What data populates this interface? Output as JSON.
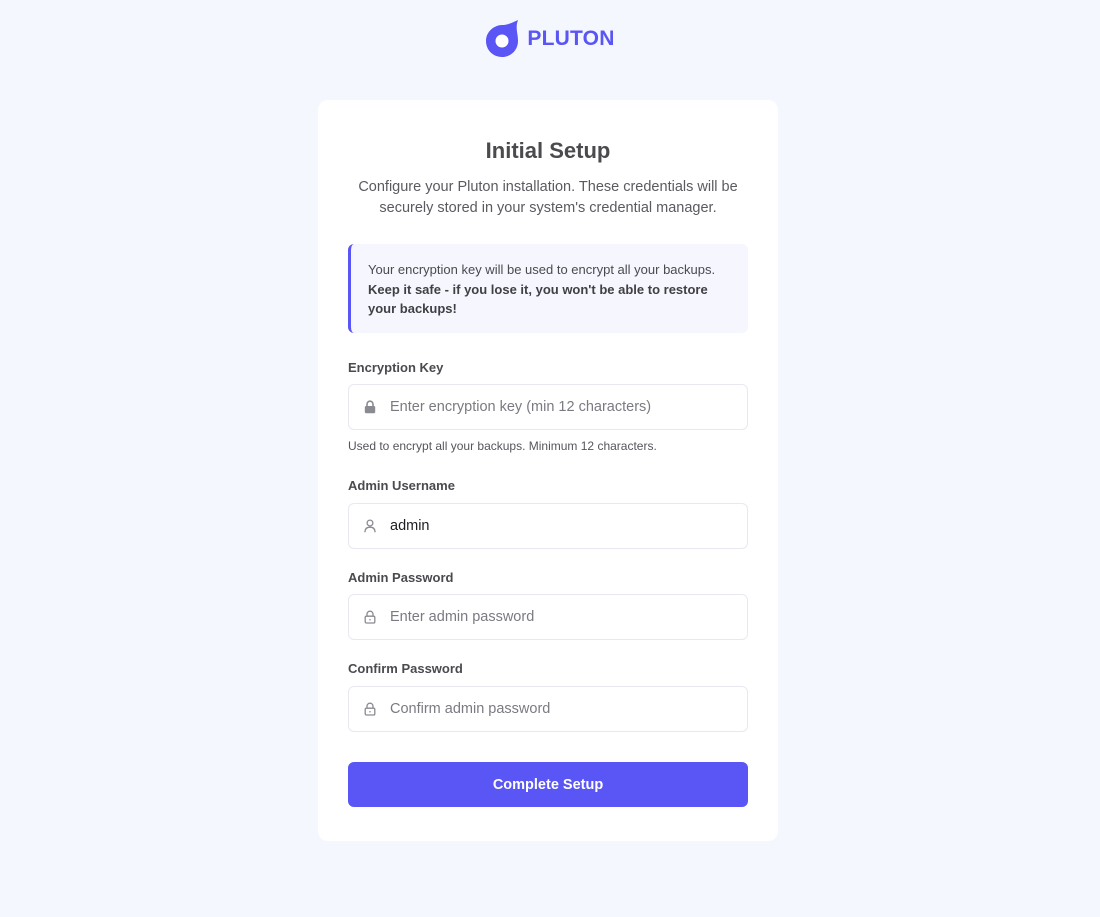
{
  "brand": {
    "name": "PLUTON"
  },
  "colors": {
    "accent": "#5a55f5",
    "background": "#f5f7fe",
    "card": "#ffffff",
    "notice_background": "#f5f6fe"
  },
  "setup": {
    "title": "Initial Setup",
    "subtitle": "Configure your Pluton installation. These credentials will be securely stored in your system's credential manager.",
    "notice": {
      "text": "Your encryption key will be used to encrypt all your backups.",
      "emphasis": "Keep it safe - if you lose it, you won't be able to restore your backups!"
    },
    "fields": {
      "encryption_key": {
        "label": "Encryption Key",
        "placeholder": "Enter encryption key (min 12 characters)",
        "value": "",
        "hint": "Used to encrypt all your backups. Minimum 12 characters.",
        "icon": "lock-icon"
      },
      "username": {
        "label": "Admin Username",
        "placeholder": "",
        "value": "admin",
        "icon": "user-icon"
      },
      "password": {
        "label": "Admin Password",
        "placeholder": "Enter admin password",
        "value": "",
        "icon": "lock-outline-icon"
      },
      "confirm_password": {
        "label": "Confirm Password",
        "placeholder": "Confirm admin password",
        "value": "",
        "icon": "lock-outline-icon"
      }
    },
    "submit_label": "Complete Setup"
  }
}
